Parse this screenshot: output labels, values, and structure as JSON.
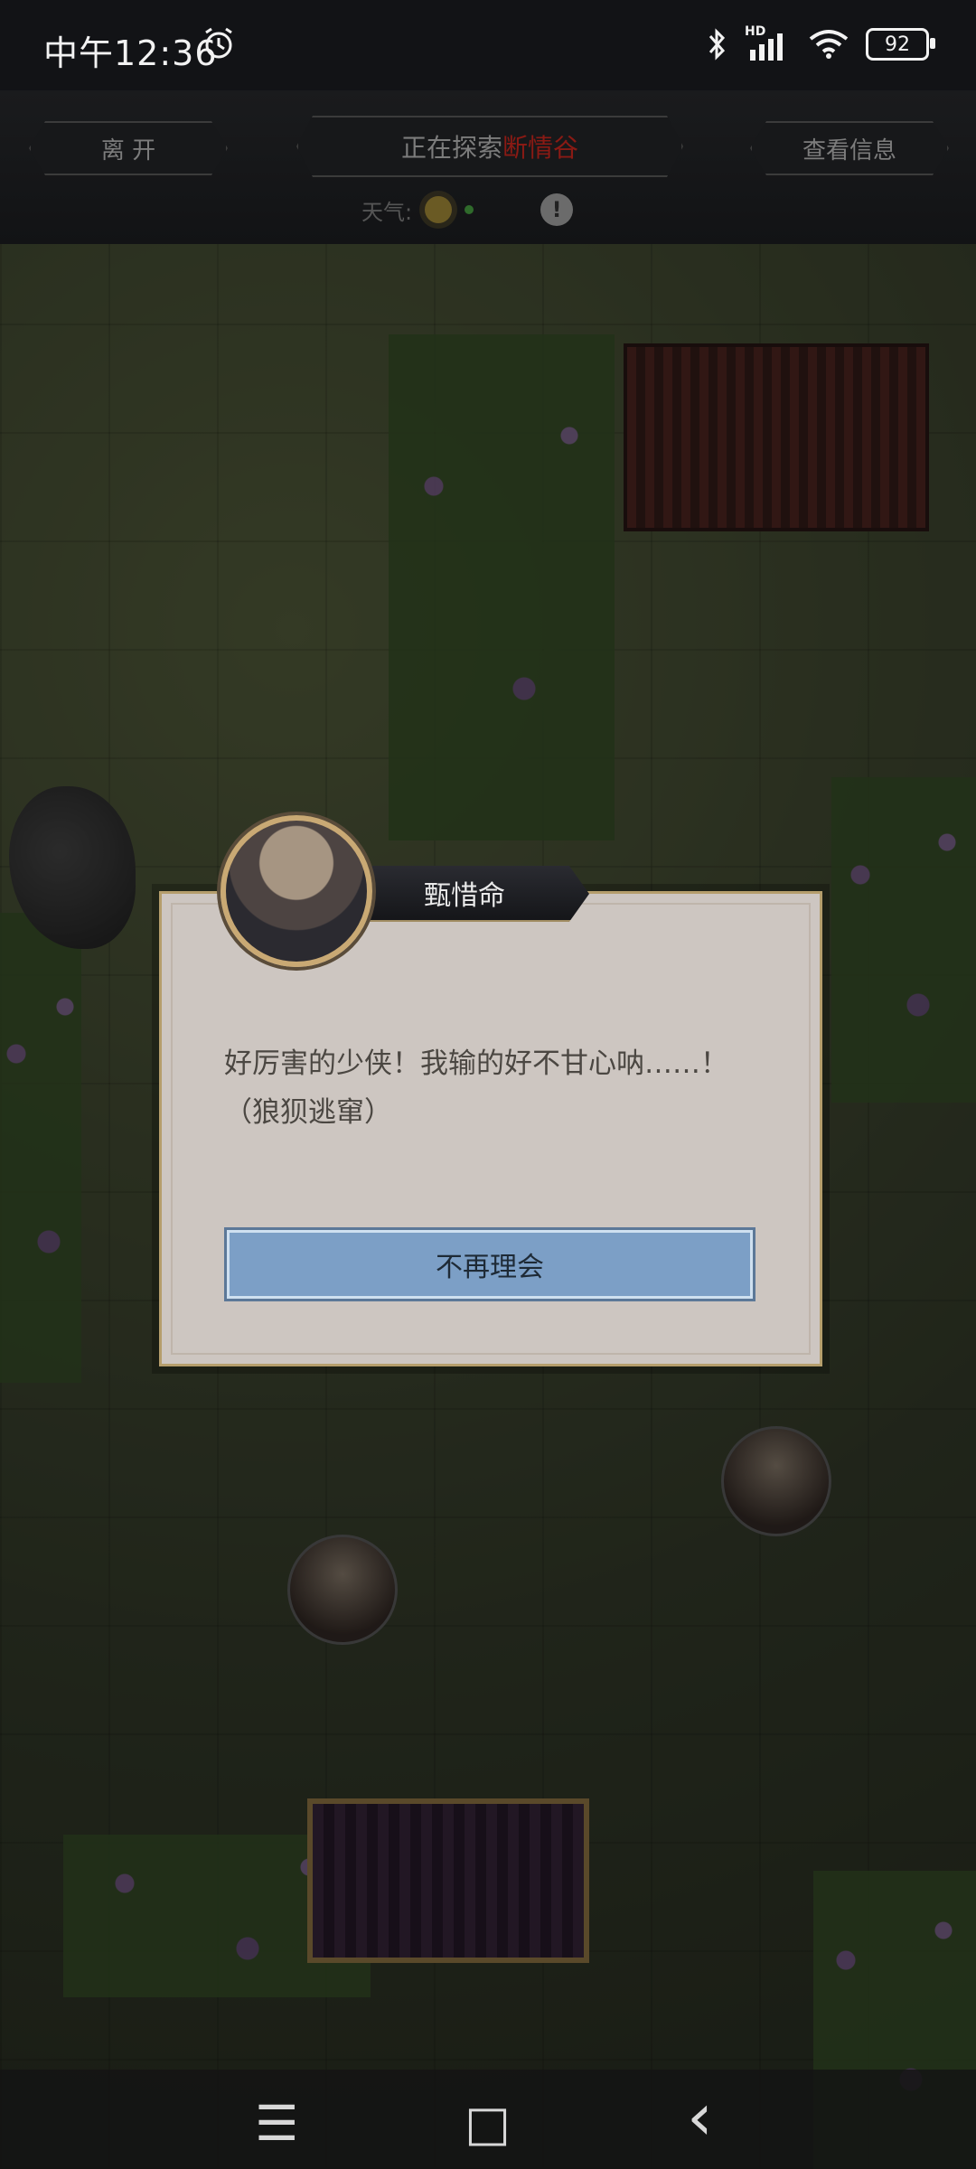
{
  "status_bar": {
    "time": "中午12:36",
    "network": "HD",
    "battery": "92"
  },
  "top_bar": {
    "leave_label": "离  开",
    "exploring_prefix": "正在探索",
    "location": "断情谷",
    "view_info_label": "查看信息",
    "weather_label": "天气:",
    "location_color": "#8a1a14"
  },
  "dialog": {
    "speaker": "甄惜命",
    "line1": "好厉害的少侠！我输的好不甘心呐……！",
    "line2": "（狼狈逃窜）",
    "button": "不再理会",
    "button_color": "#7c9fc6"
  },
  "nav_bar": {
    "menu_icon": "☰",
    "home_icon": "□",
    "back_icon": "‹"
  }
}
